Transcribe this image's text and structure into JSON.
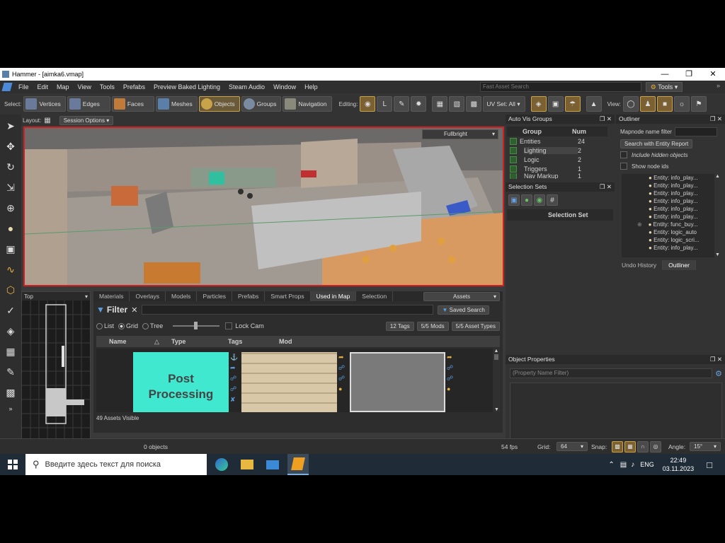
{
  "window": {
    "title": "Hammer - [aimka6.vmap]"
  },
  "menu": [
    "File",
    "Edit",
    "Map",
    "View",
    "Tools",
    "Prefabs",
    "Preview Baked Lighting",
    "Steam Audio",
    "Window",
    "Help"
  ],
  "fast_search": {
    "placeholder": "Fast Asset Search"
  },
  "tools_label": "Tools",
  "toolbar": {
    "select_label": "Select:",
    "select_modes": [
      "Vertices",
      "Edges",
      "Faces",
      "Meshes",
      "Objects",
      "Groups",
      "Navigation"
    ],
    "active_mode": "Objects",
    "editing_label": "Editing:",
    "uv_set": "UV Set: All",
    "view_label": "View:"
  },
  "layout": {
    "label": "Layout:",
    "session_options": "Session Options"
  },
  "viewport": {
    "render_mode": "Fullbright"
  },
  "minimap": {
    "view": "Top"
  },
  "assets": {
    "tabs": [
      "Materials",
      "Overlays",
      "Models",
      "Particles",
      "Prefabs",
      "Smart Props",
      "Used in Map",
      "Selection"
    ],
    "active_tab": "Used in Map",
    "dropdown": "Assets",
    "filter_label": "Filter",
    "saved_search": "Saved Search",
    "view_options": [
      "List",
      "Grid",
      "Tree"
    ],
    "selected_view": "Grid",
    "lock_cam": "Lock Cam",
    "tags_btn": "12 Tags",
    "mods_btn": "5/5 Mods",
    "types_btn": "5/5 Asset Types",
    "columns": [
      "Name",
      "Type",
      "Tags",
      "Mod"
    ],
    "tile1_text": "Post Processing",
    "visible_count": "49 Assets Visible"
  },
  "auto_vis": {
    "title": "Auto Vis Groups",
    "col_group": "Group",
    "col_num": "Num",
    "rows": [
      {
        "name": "Entities",
        "num": "24"
      },
      {
        "name": "Lighting",
        "num": "2"
      },
      {
        "name": "Logic",
        "num": "2"
      },
      {
        "name": "Triggers",
        "num": "1"
      },
      {
        "name": "Nav Markup",
        "num": "1"
      }
    ]
  },
  "selection_sets": {
    "title": "Selection Sets",
    "column": "Selection Set"
  },
  "outliner": {
    "title": "Outliner",
    "filter_label": "Mapnode name filter",
    "search_btn": "Search with Entity Report",
    "include_hidden": "Include hidden objects",
    "show_ids": "Show node ids",
    "items": [
      "Entity: info_play...",
      "Entity: info_play...",
      "Entity: info_play...",
      "Entity: info_play...",
      "Entity: info_play...",
      "Entity: info_play...",
      "Entity: func_buy...",
      "Entity: logic_auto",
      "Entity: logic_scri...",
      "Entity: info_play..."
    ],
    "tabs": [
      "Undo History",
      "Outliner"
    ]
  },
  "object_properties": {
    "title": "Object Properties",
    "filter_placeholder": "(Property Name Filter)"
  },
  "status": {
    "objects": "0 objects",
    "fps": "54 fps",
    "grid_label": "Grid:",
    "grid_value": "64",
    "snap_label": "Snap:",
    "angle_label": "Angle:",
    "angle_value": "15°"
  },
  "taskbar": {
    "search_placeholder": "Введите здесь текст для поиска",
    "lang": "ENG",
    "time": "22:49",
    "date": "03.11.2023"
  },
  "colors": {
    "accent": "#c9a34a",
    "viewport_border": "#d02020",
    "taskbar": "#1f2c38",
    "cyan_tile": "#40e8d0"
  }
}
